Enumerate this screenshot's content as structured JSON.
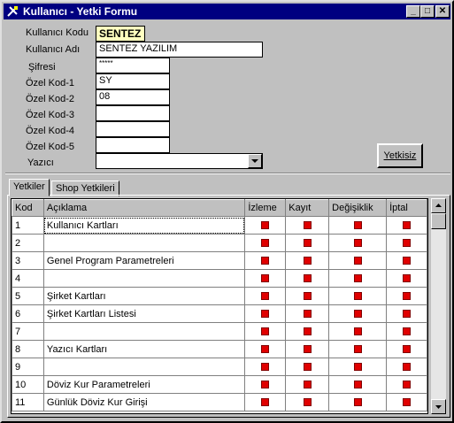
{
  "window": {
    "title": "Kullanıcı - Yetki Formu",
    "minimize_glyph": "_",
    "maximize_glyph": "□",
    "close_glyph": "✕"
  },
  "form": {
    "kullanici_kodu": {
      "label": "Kullanıcı Kodu",
      "value": "SENTEZ"
    },
    "kullanici_adi": {
      "label": "Kullanıcı Adı",
      "value": "SENTEZ YAZILIM"
    },
    "sifre": {
      "label": "Şifresi",
      "value": "*****"
    },
    "ozel_kod_1": {
      "label": "Özel Kod-1",
      "value": "SY"
    },
    "ozel_kod_2": {
      "label": "Özel Kod-2",
      "value": "08"
    },
    "ozel_kod_3": {
      "label": "Özel Kod-3",
      "value": ""
    },
    "ozel_kod_4": {
      "label": "Özel Kod-4",
      "value": ""
    },
    "ozel_kod_5": {
      "label": "Özel Kod-5",
      "value": ""
    },
    "yazici": {
      "label": "Yazıcı",
      "value": ""
    },
    "yetkisiz_button": "Yetkisiz"
  },
  "tabs": [
    {
      "label": "Yetkiler",
      "active": true
    },
    {
      "label": "Shop Yetkileri",
      "active": false
    }
  ],
  "grid": {
    "columns": [
      "Kod",
      "Açıklama",
      "İzleme",
      "Kayıt",
      "Değişiklik",
      "İptal"
    ],
    "rows": [
      {
        "kod": "1",
        "aciklama": "Kullanıcı Kartları"
      },
      {
        "kod": "2",
        "aciklama": ""
      },
      {
        "kod": "3",
        "aciklama": "Genel Program Parametreleri"
      },
      {
        "kod": "4",
        "aciklama": ""
      },
      {
        "kod": "5",
        "aciklama": "Şirket Kartları"
      },
      {
        "kod": "6",
        "aciklama": "Şirket Kartları Listesi"
      },
      {
        "kod": "7",
        "aciklama": ""
      },
      {
        "kod": "8",
        "aciklama": "Yazıcı Kartları"
      },
      {
        "kod": "9",
        "aciklama": ""
      },
      {
        "kod": "10",
        "aciklama": "Döviz Kur Parametreleri"
      },
      {
        "kod": "11",
        "aciklama": "Günlük Döviz Kur Girişi"
      }
    ]
  },
  "colors": {
    "titlebar": "#000080",
    "highlight_field": "#ffffc0",
    "checkbox": "#e00000"
  }
}
